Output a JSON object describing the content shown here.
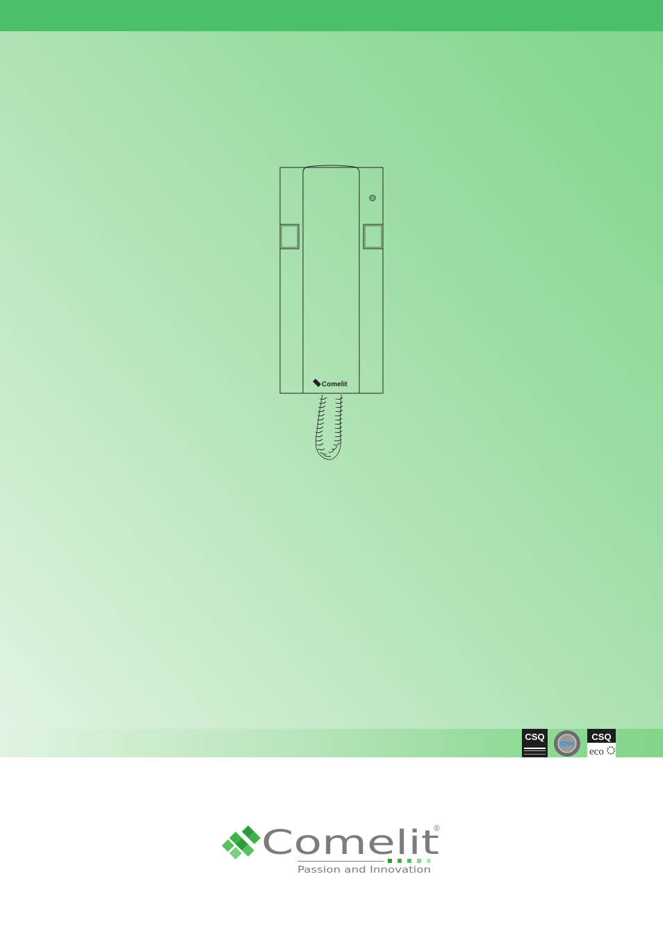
{
  "colors": {
    "top_bar": "#4cbf6b",
    "background_light": "#e3f4e3",
    "background_dark": "#80d48a",
    "brand_green": "#3db349",
    "brand_gray": "#7c7c7c"
  },
  "device": {
    "front_brand": "Comelit"
  },
  "certifications": {
    "csq_label": "CSQ",
    "csq_eco_label": "CSQ",
    "csq_eco_sub": "eco",
    "iqnet_label": "IQNet"
  },
  "logo": {
    "brand": "Comelit",
    "registered": "®",
    "tagline": "Passion and Innovation"
  }
}
